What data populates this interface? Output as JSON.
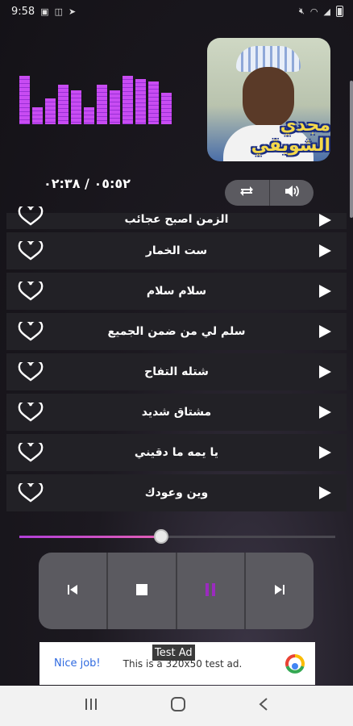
{
  "status_bar": {
    "time": "9:58",
    "left_icons": [
      "image-icon",
      "gallery-icon",
      "telegram-icon"
    ],
    "right_icons": [
      "mute-icon",
      "wifi-icon",
      "signal-icon",
      "battery-icon"
    ]
  },
  "equalizer": {
    "levels": [
      0.85,
      0.3,
      0.45,
      0.7,
      0.6,
      0.3,
      0.7,
      0.6,
      0.85,
      0.8,
      0.75,
      0.55
    ]
  },
  "album": {
    "art_title": "مجدي الشويقي"
  },
  "player": {
    "time_display": "٠٥:٥٢ / ٠٢:٣٨",
    "controls": [
      "repeat-icon",
      "volume-icon"
    ],
    "progress": 0.45
  },
  "songs": [
    {
      "title": "الزمن اصبح عجائب"
    },
    {
      "title": "ست الخمار"
    },
    {
      "title": "سلام سلام"
    },
    {
      "title": "سلم لي من ضمن الجميع"
    },
    {
      "title": "شتله التفاح"
    },
    {
      "title": "مشتاق شديد"
    },
    {
      "title": "يا يمه ما دقيني"
    },
    {
      "title": "وين وعودك"
    }
  ],
  "transport": [
    "previous-icon",
    "stop-icon",
    "pause-icon",
    "next-icon"
  ],
  "colors": {
    "accent": "#b23fd8",
    "pause_accent": "#9b2bbf",
    "panel": "#5b5a60",
    "row": "#222126"
  },
  "ad": {
    "tooltip": "Test Ad",
    "nice_job": "Nice job!",
    "text": "This is a 320x50 test ad."
  },
  "nav_bar": [
    "recents-icon",
    "home-icon",
    "back-icon"
  ]
}
